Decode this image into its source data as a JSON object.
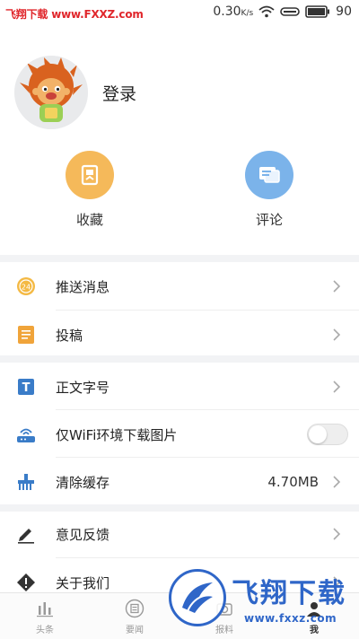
{
  "status_bar": {
    "watermark_brand": "飞翔下载",
    "watermark_site": "www.FXXZ.com",
    "net_speed": "0.30",
    "net_unit": "K/s",
    "battery": "90"
  },
  "profile": {
    "login_label": "登录"
  },
  "quick_actions": {
    "favorites_label": "收藏",
    "comments_label": "评论"
  },
  "menu": {
    "push": "推送消息",
    "submit": "投稿",
    "font_size": "正文字号",
    "wifi_images": "仅WiFi环境下载图片",
    "clear_cache": "清除缓存",
    "cache_size": "4.70MB",
    "feedback": "意见反馈",
    "about": "关于我们"
  },
  "bottom_nav": {
    "tabs": [
      {
        "label": "头条"
      },
      {
        "label": "要闻"
      },
      {
        "label": "报料"
      },
      {
        "label": "我"
      }
    ]
  },
  "watermark": {
    "title": "飞翔下载",
    "domain": "www.fxxz.com"
  },
  "colors": {
    "favorites": "#f5b95a",
    "comments": "#7bb3ea",
    "watermark_blue": "#2f66c8",
    "watermark_red": "#e0262b"
  }
}
